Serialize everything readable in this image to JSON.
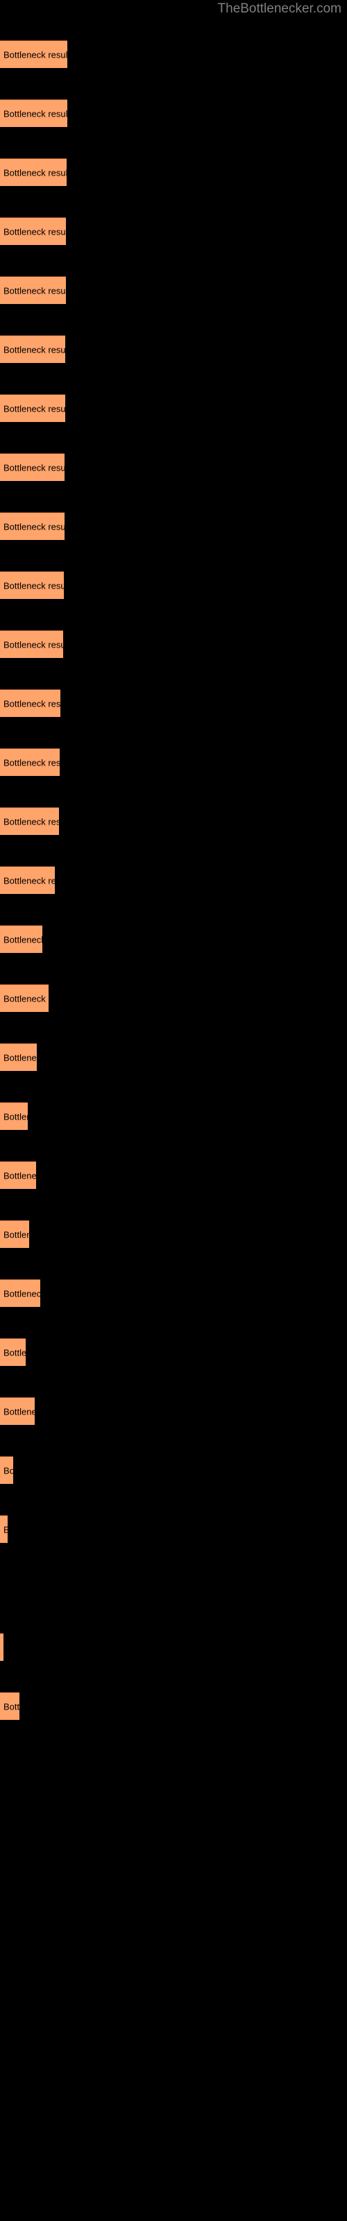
{
  "watermark": "TheBottlenecker.com",
  "colors": {
    "background": "#000000",
    "bar_fill": "#FFA46B",
    "bar_border": "#8a4a28",
    "label_text": "#000000",
    "watermark_text": "#808080"
  },
  "bar_label": "Bottleneck result",
  "chart_data": {
    "type": "bar",
    "orientation": "horizontal",
    "title": "",
    "subtitle": "",
    "xlabel": "",
    "ylabel": "",
    "grid": false,
    "legend": "none",
    "categories": [
      "Bottleneck result",
      "Bottleneck result",
      "Bottleneck result",
      "Bottleneck result",
      "Bottleneck result",
      "Bottleneck result",
      "Bottleneck result",
      "Bottleneck result",
      "Bottleneck result",
      "Bottleneck result",
      "Bottleneck result",
      "Bottleneck result",
      "Bottleneck result",
      "Bottleneck result",
      "Bottleneck result",
      "Bottleneck result",
      "Bottleneck result",
      "Bottleneck result",
      "Bottleneck result",
      "Bottleneck result",
      "Bottleneck result",
      "Bottleneck result",
      "Bottleneck result",
      "Bottleneck result",
      "Bottleneck result",
      "Bottleneck result",
      "Bottleneck result",
      "Bottleneck result",
      "Bottleneck result",
      "Bottleneck result",
      "Bottleneck result"
    ],
    "values": [
      97,
      97,
      96,
      95,
      95,
      94,
      94,
      93,
      93,
      92,
      91,
      87,
      86,
      85,
      79,
      72,
      69,
      64,
      56,
      60,
      50,
      62,
      44,
      52,
      22,
      16,
      12,
      1,
      7,
      5,
      29
    ],
    "xlim": [
      0,
      100
    ],
    "ylim": null,
    "bar_tops": [
      56,
      127,
      198,
      269,
      340,
      411,
      482,
      553,
      624,
      695,
      766,
      837,
      908,
      979,
      1050,
      1121,
      1192,
      1263,
      1334,
      1405,
      1476,
      1547,
      1618,
      1689,
      1760,
      1831,
      1902,
      1973,
      2044,
      2115,
      2186
    ]
  },
  "bars": [
    {
      "width": 97,
      "top": 58
    },
    {
      "width": 97,
      "top": 143
    },
    {
      "width": 96,
      "top": 228
    },
    {
      "width": 95,
      "top": 313
    },
    {
      "width": 95,
      "top": 398
    },
    {
      "width": 94,
      "top": 483
    },
    {
      "width": 94,
      "top": 568
    },
    {
      "width": 93,
      "top": 653
    },
    {
      "width": 93,
      "top": 738
    },
    {
      "width": 92,
      "top": 823
    },
    {
      "width": 91,
      "top": 908
    },
    {
      "width": 87,
      "top": 993
    },
    {
      "width": 86,
      "top": 1078
    },
    {
      "width": 85,
      "top": 1163
    },
    {
      "width": 79,
      "top": 1248
    },
    {
      "width": 61,
      "top": 1333
    },
    {
      "width": 70,
      "top": 1418
    },
    {
      "width": 53,
      "top": 1503
    },
    {
      "width": 40,
      "top": 1588
    },
    {
      "width": 52,
      "top": 1673
    },
    {
      "width": 42,
      "top": 1758
    },
    {
      "width": 58,
      "top": 1843
    },
    {
      "width": 37,
      "top": 1928
    },
    {
      "width": 50,
      "top": 2013
    },
    {
      "width": 19,
      "top": 2098
    },
    {
      "width": 11,
      "top": 2183
    },
    {
      "width": 0,
      "top": 2268
    },
    {
      "width": 5,
      "top": 2353
    },
    {
      "width": 28,
      "top": 2438
    }
  ]
}
